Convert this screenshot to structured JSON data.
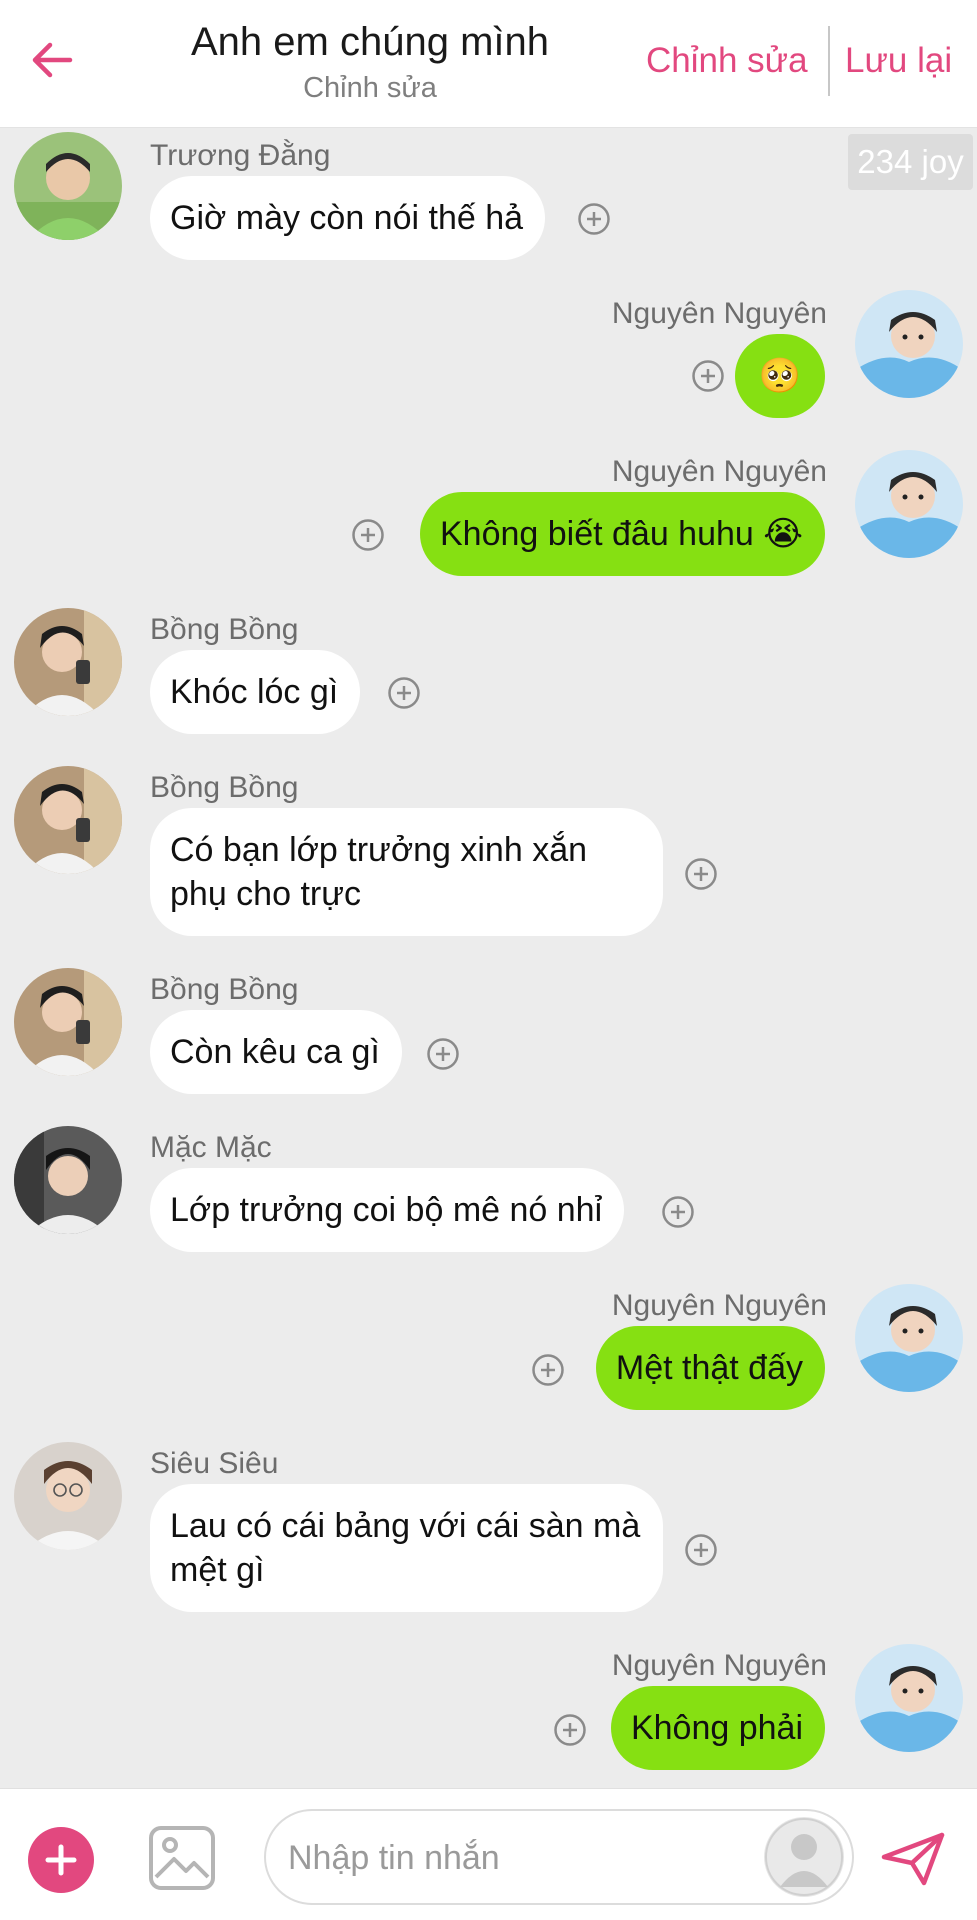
{
  "header": {
    "title": "Anh em chúng mình",
    "subtitle": "Chỉnh sửa",
    "edit_label": "Chỉnh sửa",
    "save_label": "Lưu lại",
    "back_icon": "arrow-left-icon",
    "accent_color": "#e2487f"
  },
  "joy_badge": "234 joy",
  "messages": [
    {
      "sender": "Trương Đằng",
      "side": "left",
      "text": "Giờ mày còn nói thế hả"
    },
    {
      "sender": "Nguyên Nguyên",
      "side": "right",
      "text": "🥺"
    },
    {
      "sender": "Nguyên Nguyên",
      "side": "right",
      "text": "Không biết đâu huhu 😭"
    },
    {
      "sender": "Bồng Bồng",
      "side": "left",
      "text": "Khóc lóc gì"
    },
    {
      "sender": "Bồng Bồng",
      "side": "left",
      "text": "Có bạn lớp trưởng xinh xắn phụ cho trực"
    },
    {
      "sender": "Bồng Bồng",
      "side": "left",
      "text": "Còn kêu ca gì"
    },
    {
      "sender": "Mặc Mặc",
      "side": "left",
      "text": "Lớp trưởng coi bộ mê nó nhỉ"
    },
    {
      "sender": "Nguyên Nguyên",
      "side": "right",
      "text": "Mệt thật đấy"
    },
    {
      "sender": "Siêu Siêu",
      "side": "left",
      "text": "Lau có cái bảng với cái sàn mà mệt gì"
    },
    {
      "sender": "Nguyên Nguyên",
      "side": "right",
      "text": "Không phải"
    }
  ],
  "composer": {
    "placeholder": "Nhập tin nhắn",
    "add_icon": "plus-icon",
    "image_icon": "image-icon",
    "voice_icon": "avatar-placeholder-icon",
    "send_icon": "send-icon"
  },
  "colors": {
    "incoming_bubble": "#ffffff",
    "outgoing_bubble": "#86e012",
    "background": "#ececec"
  }
}
